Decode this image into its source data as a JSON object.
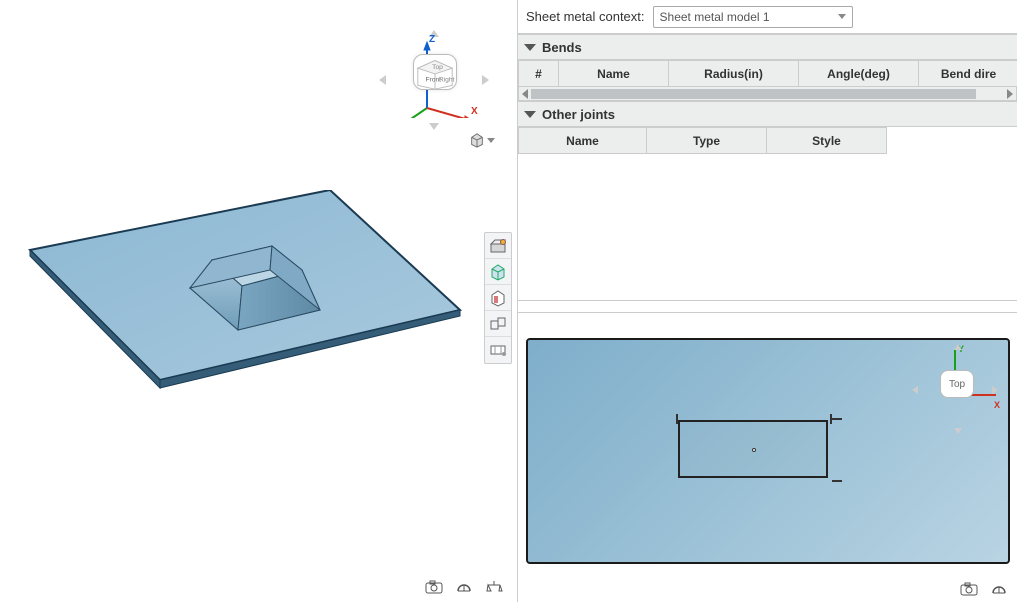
{
  "context": {
    "label": "Sheet metal context:",
    "selected": "Sheet metal model 1"
  },
  "sections": {
    "bends": {
      "title": "Bends",
      "columns": [
        "#",
        "Name",
        "Radius(in)",
        "Angle(deg)",
        "Bend dire"
      ]
    },
    "joints": {
      "title": "Other joints",
      "columns": [
        "Name",
        "Type",
        "Style"
      ]
    }
  },
  "axes_left": {
    "z": "Z",
    "x": "X",
    "front": "Front",
    "right": "Right",
    "top": "Top"
  },
  "axes_right": {
    "y": "Y",
    "x": "X",
    "top": "Top"
  },
  "toolbar_names": [
    "show-hide-model-button",
    "iso-view-button",
    "section-view-button",
    "unfold-button",
    "flat-pattern-button"
  ],
  "icons": {
    "bl": [
      "snapshot-icon",
      "section-analysis-icon",
      "mass-props-icon"
    ],
    "br": [
      "snapshot-icon",
      "section-analysis-icon"
    ]
  }
}
